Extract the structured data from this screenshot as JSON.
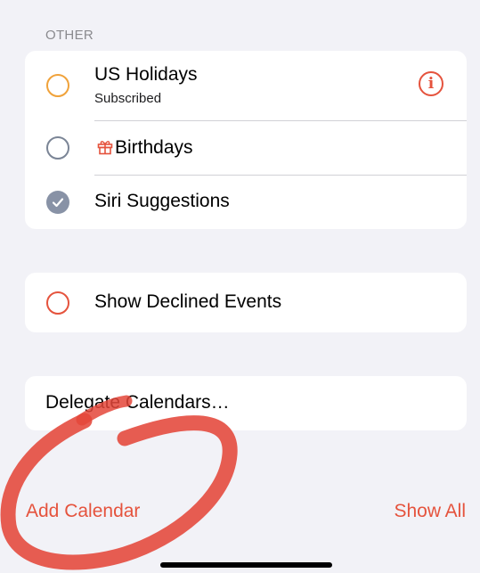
{
  "section": {
    "header": "OTHER"
  },
  "calendars": [
    {
      "label": "US Holidays",
      "subtitle": "Subscribed",
      "state": "unchecked",
      "color": "#f0a23a",
      "trailing_icon": "info-icon"
    },
    {
      "label": "Birthdays",
      "state": "unchecked",
      "color": "#7b8596",
      "leading_icon": "gift-icon"
    },
    {
      "label": "Siri Suggestions",
      "state": "checked",
      "color": "#8892a6"
    }
  ],
  "declined": {
    "label": "Show Declined Events",
    "state": "unchecked",
    "color": "#e5533d"
  },
  "delegate": {
    "label": "Delegate Calendars…"
  },
  "toolbar": {
    "add_label": "Add Calendar",
    "show_all_label": "Show All"
  },
  "colors": {
    "accent": "#e5533d",
    "background": "#f2f2f7",
    "card": "#ffffff"
  },
  "info_glyph": "i"
}
